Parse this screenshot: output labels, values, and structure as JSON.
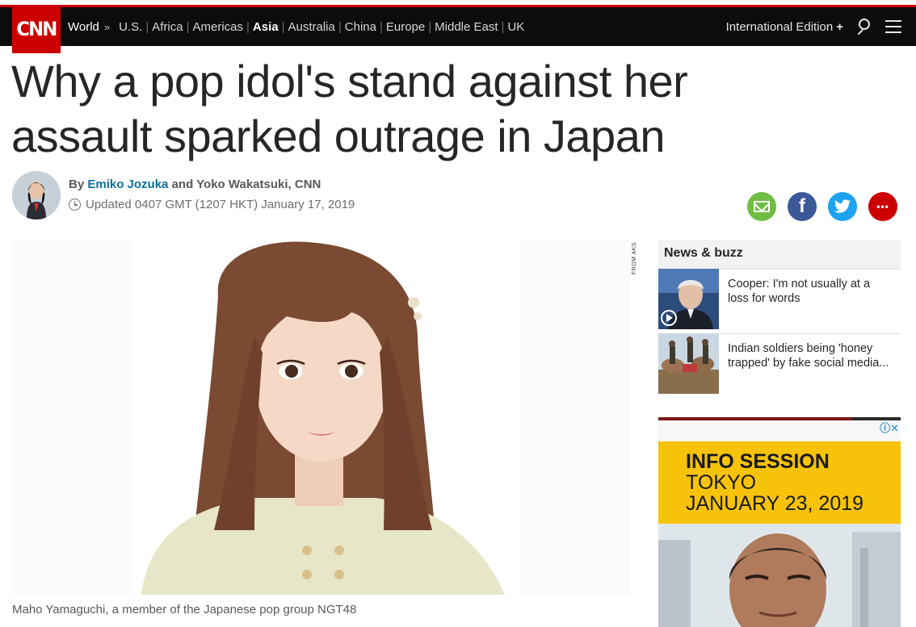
{
  "brand": {
    "logo_text": "CNN",
    "accent": "#cc0000"
  },
  "nav": {
    "section": "World",
    "separator": "»",
    "links": [
      "U.S.",
      "Africa",
      "Americas",
      "Asia",
      "Australia",
      "China",
      "Europe",
      "Middle East",
      "UK"
    ],
    "active": "Asia",
    "edition": "International Edition",
    "edition_icon": "+",
    "search_icon": "search-icon",
    "menu_icon": "hamburger-menu-icon"
  },
  "article": {
    "headline": "Why a pop idol's stand against her assault sparked outrage in Japan",
    "byline_prefix": "By",
    "author1": "Emiko Jozuka",
    "byline_and": "and",
    "author2": "Yoko Wakatsuki, CNN",
    "updated": "Updated 0407 GMT (1207 HKT) January 17, 2019",
    "caption": "Maho Yamaguchi, a member of the Japanese pop group NGT48",
    "image_credit": "FROM AKS"
  },
  "share": {
    "email": "email-share-icon",
    "facebook": "f",
    "twitter": "twitter-bird-icon",
    "more": "•••"
  },
  "sidebar": {
    "title": "News & buzz",
    "items": [
      {
        "text": "Cooper: I'm not usually at a loss for words",
        "has_video": true
      },
      {
        "text": "Indian soldiers being 'honey trapped' by fake social media..."
      }
    ]
  },
  "ad": {
    "line1": "INFO SESSION",
    "line2": "TOKYO",
    "line3": "JANUARY 23, 2019",
    "choices": "ⓘ✕",
    "band_color": "#f7c30a"
  }
}
